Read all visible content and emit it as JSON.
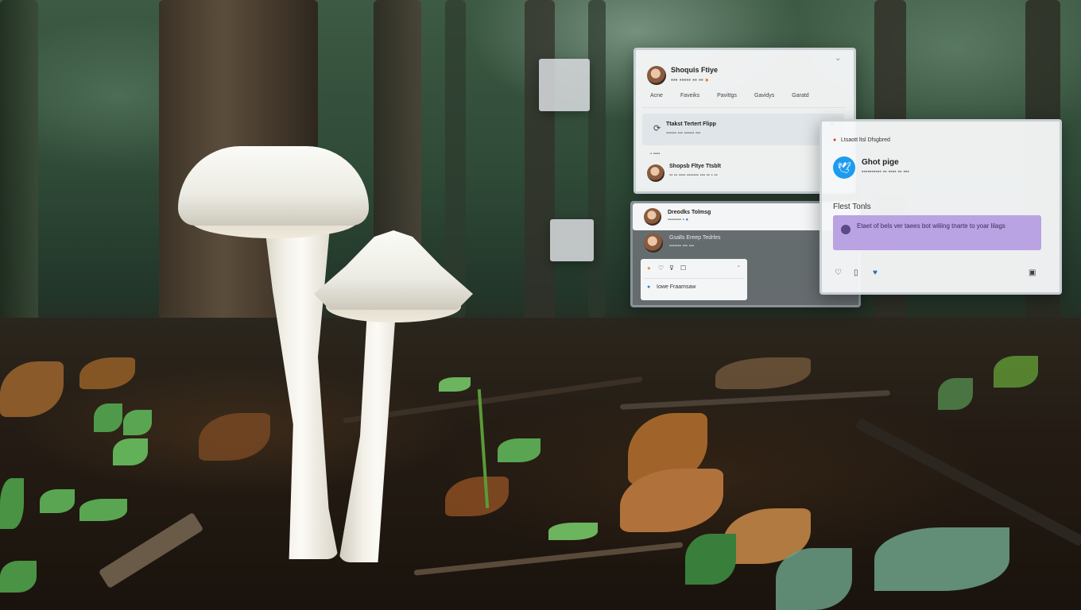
{
  "panel_a": {
    "name": "Shoquis Ftiye",
    "nav": [
      "Acne",
      "Faveiks",
      "Pavittgs",
      "Gavidys",
      "Garatd"
    ],
    "highlight_title": "Ttakst Tertert Flipp",
    "post_name": "Shopsb Fltye Ttsblt",
    "close_glyph": "⌄",
    "collapse_glyph": "▾"
  },
  "panel_b": {
    "name": "Dreodks Tolmsg",
    "sub_name": "Gsalls Ereep Tedrles",
    "mini_button_label": "Iowe Fraamsaw"
  },
  "panel_c": {
    "header": "Ltsaott ltsl Dfsgbred",
    "profile_name": "Ghot pige",
    "section_title": "Flest Tonls",
    "message": "Etaet of bels ver taees bot wiliing tnarte to yoar lilags",
    "accent_color": "#1d9bf0",
    "message_bg": "#b9a3e3",
    "icons": [
      "heart-icon",
      "copy-icon",
      "like-icon",
      "save-icon"
    ]
  }
}
